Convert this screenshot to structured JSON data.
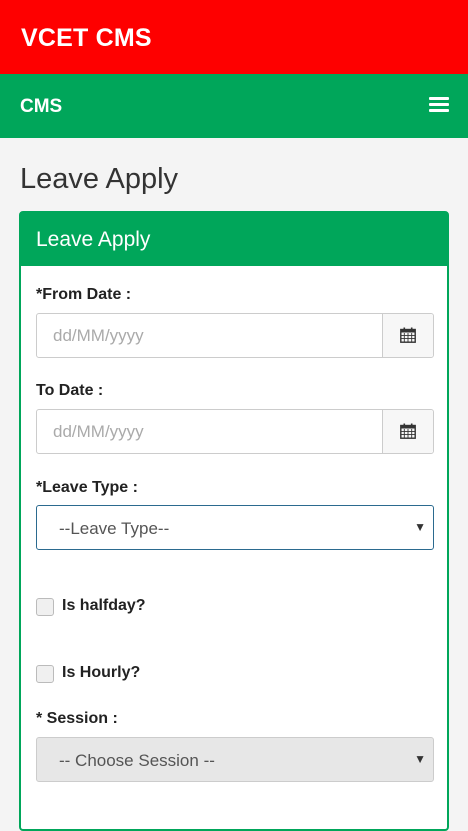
{
  "app": {
    "title": "VCET CMS"
  },
  "nav": {
    "brand": "CMS",
    "menu_icon": "hamburger-icon"
  },
  "page": {
    "title": "Leave Apply"
  },
  "panel": {
    "title": "Leave Apply"
  },
  "form": {
    "from_date": {
      "label": "*From Date :",
      "placeholder": "dd/MM/yyyy",
      "value": "",
      "icon": "calendar-icon"
    },
    "to_date": {
      "label": "To Date :",
      "placeholder": "dd/MM/yyyy",
      "value": "",
      "icon": "calendar-icon"
    },
    "leave_type": {
      "label": "*Leave Type :",
      "selected": "--Leave Type--"
    },
    "is_halfday": {
      "label": "Is halfday?",
      "checked": false
    },
    "is_hourly": {
      "label": "Is Hourly?",
      "checked": false
    },
    "session": {
      "label": "* Session :",
      "selected": "-- Choose Session --"
    }
  },
  "colors": {
    "header_red": "#fe0000",
    "nav_green": "#00a65a",
    "panel_border": "#00a65a",
    "focus_border": "#2b6a8f"
  }
}
